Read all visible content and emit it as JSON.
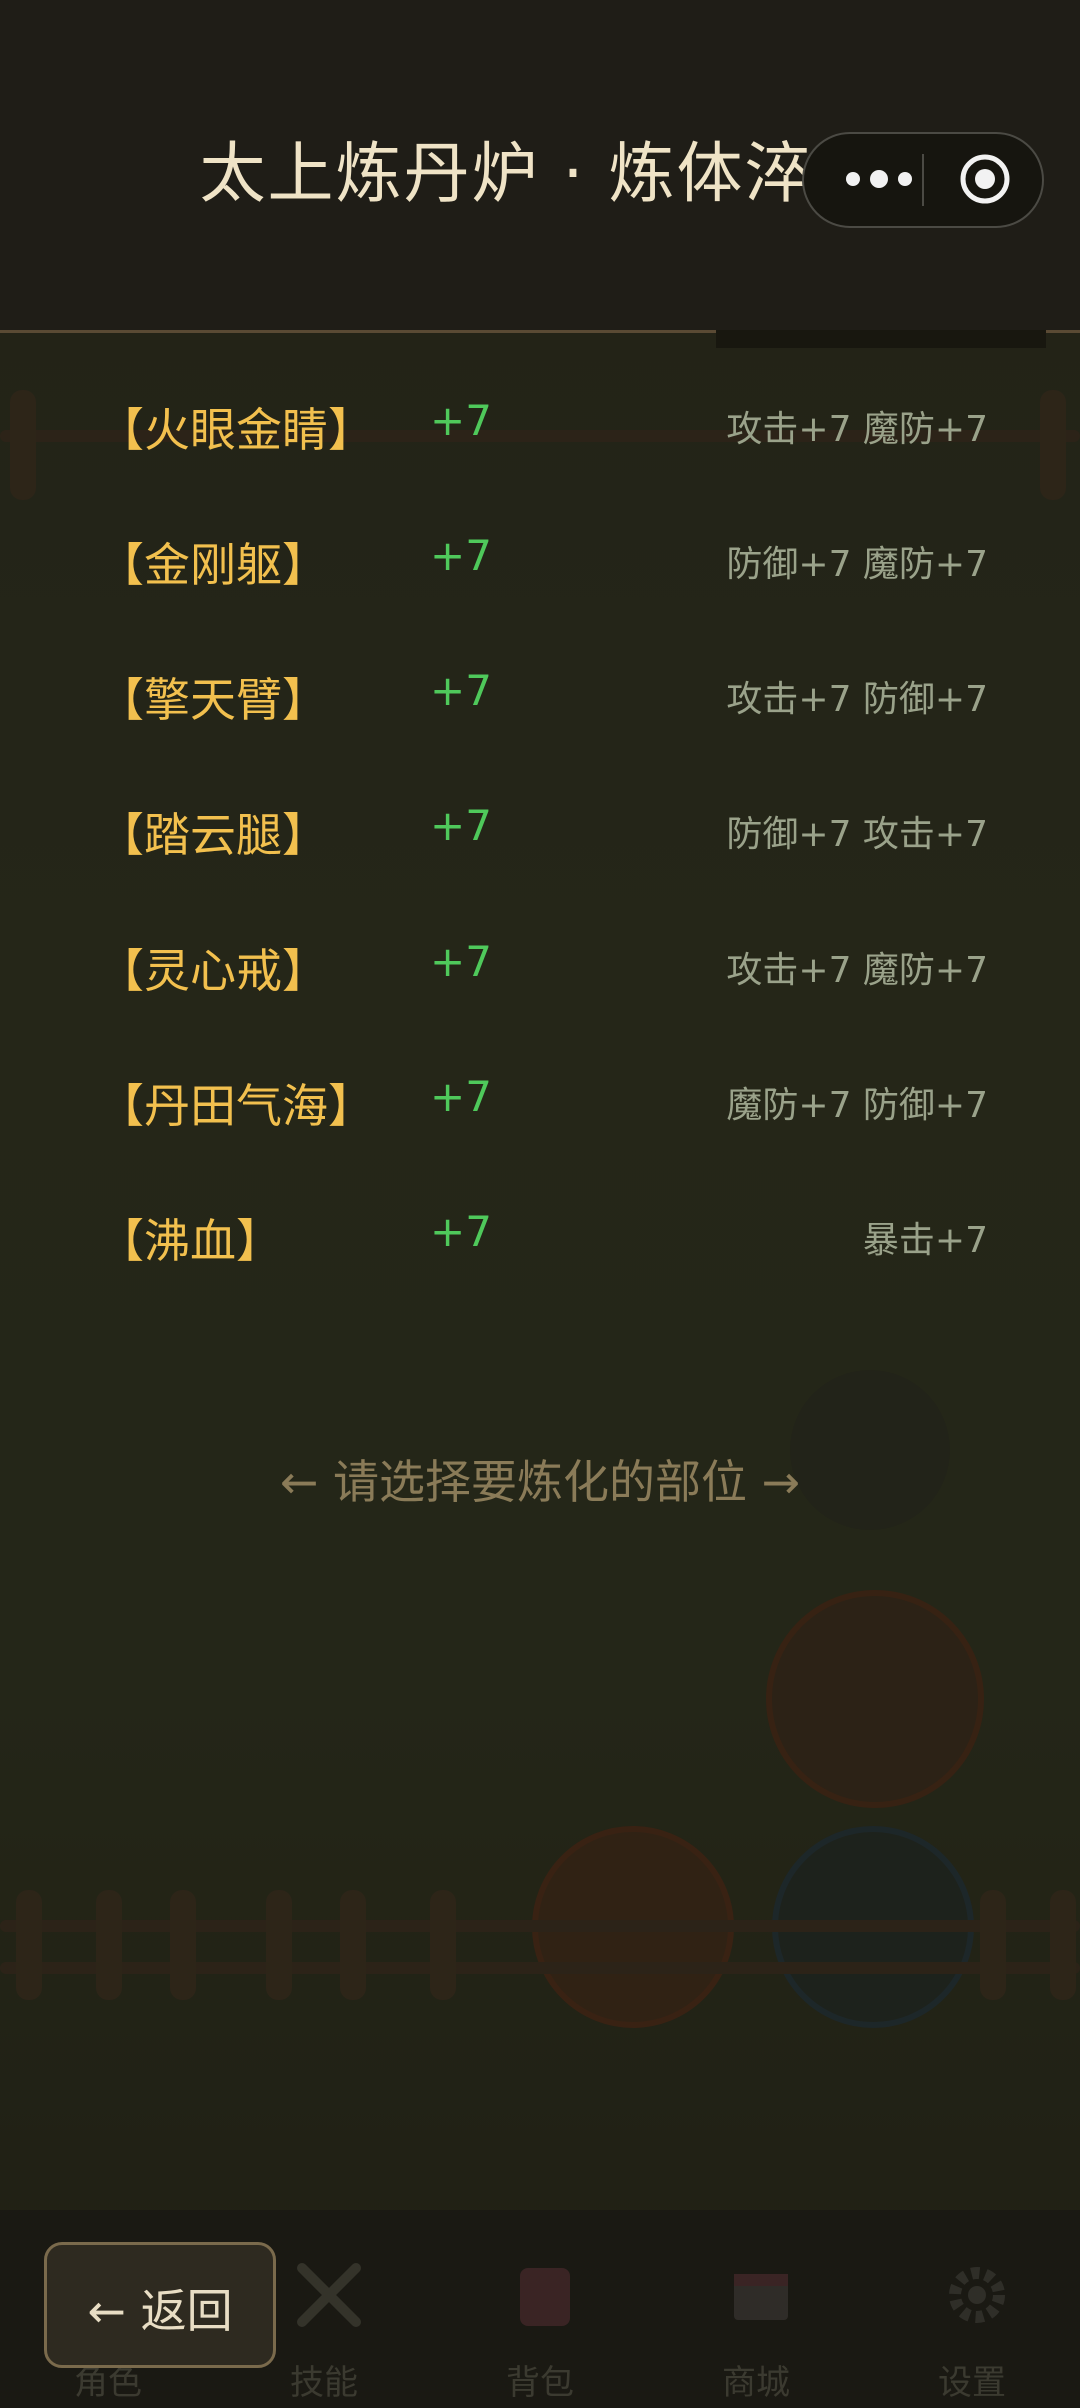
{
  "header": {
    "title": "太上炼丹炉 · 炼体淬体"
  },
  "parts": [
    {
      "name": "【火眼金睛】",
      "level": "+7",
      "stats": "攻击+7  魔防+7"
    },
    {
      "name": "【金刚躯】",
      "level": "+7",
      "stats": "防御+7  魔防+7"
    },
    {
      "name": "【擎天臂】",
      "level": "+7",
      "stats": "攻击+7  防御+7"
    },
    {
      "name": "【踏云腿】",
      "level": "+7",
      "stats": "防御+7  攻击+7"
    },
    {
      "name": "【灵心戒】",
      "level": "+7",
      "stats": "攻击+7  魔防+7"
    },
    {
      "name": "【丹田气海】",
      "level": "+7",
      "stats": "魔防+7  防御+7"
    },
    {
      "name": "【沸血】",
      "level": "+7",
      "stats": "暴击+7"
    }
  ],
  "hint": "← 请选择要炼化的部位 →",
  "back_button": {
    "label": "← 返回"
  },
  "nav": {
    "items": [
      {
        "label": "角色",
        "icon": "character-icon"
      },
      {
        "label": "技能",
        "icon": "crossed-swords-icon"
      },
      {
        "label": "背包",
        "icon": "backpack-icon"
      },
      {
        "label": "商城",
        "icon": "shop-icon"
      },
      {
        "label": "设置",
        "icon": "gear-icon"
      }
    ]
  },
  "colors": {
    "part_name": "#f2c04e",
    "level": "#4fc95b",
    "stats": "#9aa28a",
    "title": "#efe3c6"
  }
}
